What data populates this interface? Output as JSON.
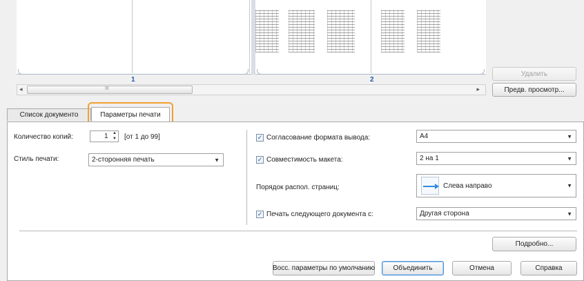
{
  "preview": {
    "sheets": [
      {
        "label": "1"
      },
      {
        "label": "2"
      }
    ],
    "scroll_thumb_glyph": "III",
    "delete_button": "Удалить",
    "preview_button": "Предв. просмотр..."
  },
  "tabs": [
    {
      "label": "Список документо"
    },
    {
      "label": "Параметры печати",
      "active": true
    }
  ],
  "print_settings": {
    "copies_label": "Количество копий:",
    "copies_value": "1",
    "copies_range": "[от 1 до 99]",
    "style_label": "Стиль печати:",
    "style_value": "2-сторонняя печать",
    "output_format": {
      "label": "Согласование формата вывода:",
      "checked": true,
      "value": "A4"
    },
    "layout_compat": {
      "label": "Совместимость макета:",
      "checked": true,
      "value": "2 на 1"
    },
    "page_order": {
      "label": "Порядок распол. страниц:",
      "value": "Слева направо"
    },
    "next_doc": {
      "label": "Печать следующего документа с:",
      "checked": true,
      "value": "Другая сторона"
    },
    "details_button": "Подробно..."
  },
  "footer": {
    "restore_defaults": "Восс. параметры по умолчанию",
    "merge": "Объединить",
    "cancel": "Отмена",
    "help": "Справка"
  },
  "colors": {
    "accent": "#1e5aa8",
    "tab_highlight": "#f0a030"
  }
}
